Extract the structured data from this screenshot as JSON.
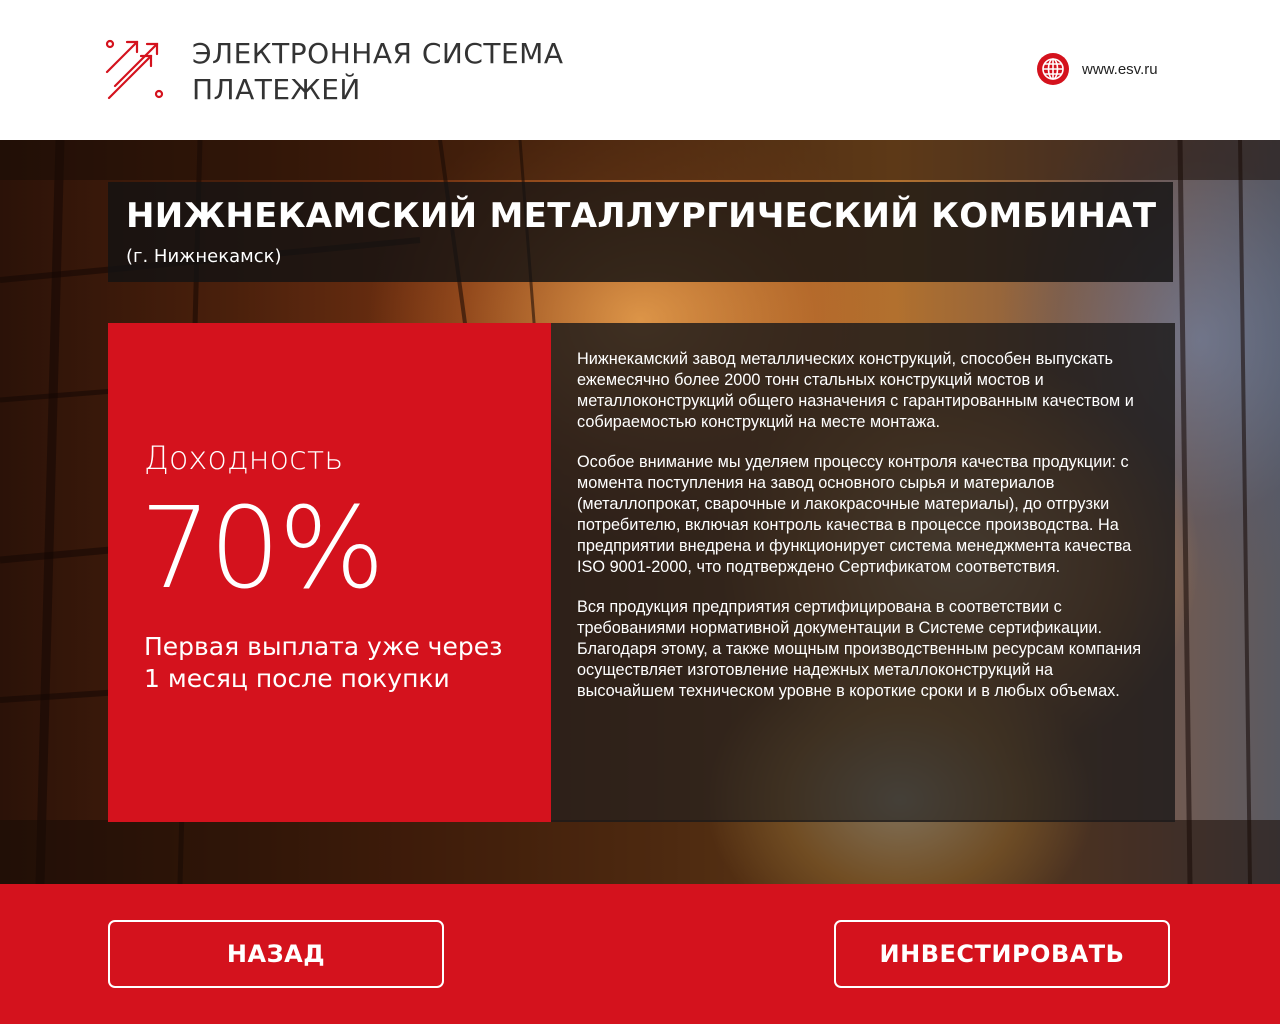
{
  "header": {
    "logo_line1": "ЭЛЕКТРОННАЯ СИСТЕМА",
    "logo_line2": "ПЛАТЕЖЕЙ",
    "site_url": "www.esv.ru",
    "site_icon": "globe-icon",
    "logo_icon": "arrows-logo-icon",
    "brand_color": "#d4121d"
  },
  "project": {
    "title": "НИЖНЕКАМСКИЙ МЕТАЛЛУРГИЧЕСКИЙ КОМБИНАТ",
    "subtitle": "(г. Нижнекамск)"
  },
  "yield": {
    "label": "Доходность",
    "value": "70%",
    "note_line1": "Первая выплата уже через",
    "note_line2": "1 месяц после покупки"
  },
  "description": {
    "paragraph1": "Нижнекамский завод металлических конструкций, способен выпускать ежемесячно более 2000 тонн стальных конструкций мостов и металлоконструкций общего назначения с гарантированным качеством и собираемостью конструкций на месте монтажа.",
    "paragraph2": "Особое внимание мы уделяем процессу контроля качества продукции: с момента поступления на завод основного сырья и материалов (металлопрокат, сварочные и лакокрасочные материалы), до отгрузки потребителю, включая контроль качества в процессе производства. На предприятии внедрена и функционирует система менеджмента качества ISO 9001-2000, что подтверждено Сертификатом соответствия.",
    "paragraph3": "Вся продукция предприятия сертифицирована в соответствии с требованиями нормативной документации в Системе сертификации. Благодаря этому, а также мощным производственным ресурсам компания осуществляет изготовление надежных металлоконструкций на высочайшем техническом уровне в короткие сроки и в любых объемах."
  },
  "footer": {
    "back_label": "НАЗАД",
    "invest_label": "ИНВЕСТИРОВАТЬ"
  }
}
